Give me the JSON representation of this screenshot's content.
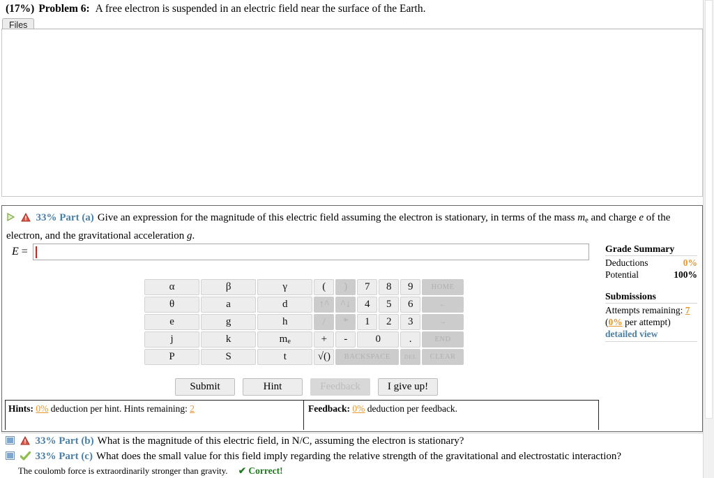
{
  "problem": {
    "percent": "(17%)",
    "number": "Problem 6:",
    "statement": "A free electron is suspended in an electric field near the surface of the Earth."
  },
  "tabs": {
    "files_label": "Files"
  },
  "part_a": {
    "percent_label": "33% Part (a)",
    "text_1": "Give an expression for the magnitude of this electric field assuming the electron is stationary, in terms of the mass ",
    "mass_symbol": "m",
    "mass_sub": "e",
    "text_2": " and charge ",
    "charge_symbol": "e",
    "text_3": " of the electron, and the gravitational acceleration ",
    "gravity_symbol": "g",
    "text_4": ".",
    "answer_label": "E",
    "answer_equals": "=",
    "answer_value": "",
    "answer_placeholder": ""
  },
  "keypad": {
    "rows": [
      [
        {
          "label": "α",
          "kind": "sym",
          "disabled": false
        },
        {
          "label": "β",
          "kind": "sym",
          "disabled": false
        },
        {
          "label": "γ",
          "kind": "sym",
          "disabled": false
        },
        {
          "label": "(",
          "kind": "par",
          "disabled": false
        },
        {
          "label": ")",
          "kind": "par",
          "disabled": true
        },
        {
          "label": "7",
          "kind": "num",
          "disabled": false
        },
        {
          "label": "8",
          "kind": "num",
          "disabled": false
        },
        {
          "label": "9",
          "kind": "num",
          "disabled": false
        },
        {
          "label": "HOME",
          "kind": "fn",
          "disabled": true
        }
      ],
      [
        {
          "label": "θ",
          "kind": "sym",
          "disabled": false
        },
        {
          "label": "a",
          "kind": "sym",
          "disabled": false
        },
        {
          "label": "d",
          "kind": "sym",
          "disabled": false
        },
        {
          "label": "↑^",
          "kind": "par",
          "disabled": true
        },
        {
          "label": "^↓",
          "kind": "par",
          "disabled": true
        },
        {
          "label": "4",
          "kind": "num",
          "disabled": false
        },
        {
          "label": "5",
          "kind": "num",
          "disabled": false
        },
        {
          "label": "6",
          "kind": "num",
          "disabled": false
        },
        {
          "label": "←",
          "kind": "fn",
          "disabled": true
        }
      ],
      [
        {
          "label": "e",
          "kind": "sym",
          "disabled": false
        },
        {
          "label": "g",
          "kind": "sym",
          "disabled": false
        },
        {
          "label": "h",
          "kind": "sym",
          "disabled": false
        },
        {
          "label": "/",
          "kind": "par",
          "disabled": true
        },
        {
          "label": "*",
          "kind": "par",
          "disabled": true
        },
        {
          "label": "1",
          "kind": "num",
          "disabled": false
        },
        {
          "label": "2",
          "kind": "num",
          "disabled": false
        },
        {
          "label": "3",
          "kind": "num",
          "disabled": false
        },
        {
          "label": "→",
          "kind": "fn",
          "disabled": true
        }
      ],
      [
        {
          "label": "j",
          "kind": "sym",
          "disabled": false
        },
        {
          "label": "k",
          "kind": "sym",
          "disabled": false
        },
        {
          "label": "me",
          "kind": "sym",
          "disabled": false,
          "sub": "e",
          "base": "m"
        },
        {
          "label": "+",
          "kind": "par",
          "disabled": false
        },
        {
          "label": "-",
          "kind": "par",
          "disabled": false
        },
        {
          "label": "0",
          "kind": "zero",
          "disabled": false
        },
        {
          "label": ".",
          "kind": "num",
          "disabled": false
        },
        {
          "label": "END",
          "kind": "fn",
          "disabled": true
        }
      ],
      [
        {
          "label": "P",
          "kind": "sym",
          "disabled": false
        },
        {
          "label": "S",
          "kind": "sym",
          "disabled": false
        },
        {
          "label": "t",
          "kind": "sym",
          "disabled": false
        },
        {
          "label": "√()",
          "kind": "par",
          "disabled": false
        },
        {
          "label": "BACKSPACE",
          "kind": "back",
          "disabled": true
        },
        {
          "label": "DEL",
          "kind": "del",
          "disabled": true
        },
        {
          "label": "CLEAR",
          "kind": "fn",
          "disabled": true
        }
      ]
    ]
  },
  "actions": {
    "submit": "Submit",
    "hint": "Hint",
    "feedback": "Feedback",
    "give_up": "I give up!"
  },
  "hints_bar": {
    "hints_title": "Hints:",
    "hints_percent": "0%",
    "hints_text": "deduction per hint. Hints remaining:",
    "hints_remaining": "2",
    "feedback_title": "Feedback:",
    "feedback_percent": "0%",
    "feedback_text": "deduction per feedback."
  },
  "grade_summary": {
    "title": "Grade Summary",
    "deductions_label": "Deductions",
    "deductions_value": "0%",
    "potential_label": "Potential",
    "potential_value": "100%",
    "submissions_title": "Submissions",
    "attempts_label": "Attempts remaining:",
    "attempts_value": "7",
    "per_attempt_open": "(",
    "per_attempt_percent": "0%",
    "per_attempt_text": " per attempt)",
    "detailed_view": "detailed view"
  },
  "part_b": {
    "percent_label": "33% Part (b)",
    "text": "What is the magnitude of this electric field, in N/C, assuming the electron is stationary?"
  },
  "part_c": {
    "percent_label": "33% Part (c)",
    "text": "What does the small value for this field imply regarding the relative strength of the gravitational and electrostatic interaction?",
    "answer": "The coulomb force is extraordinarily stronger than gravity.",
    "status": "✔ Correct!"
  },
  "colors": {
    "part_label_blue": "#4b7fa6",
    "orange": "#e8962e",
    "correct_green": "#1f7a1f",
    "warn_red": "#c0392b",
    "key_bg": "#ededed",
    "key_disabled_bg": "#cccccc"
  }
}
